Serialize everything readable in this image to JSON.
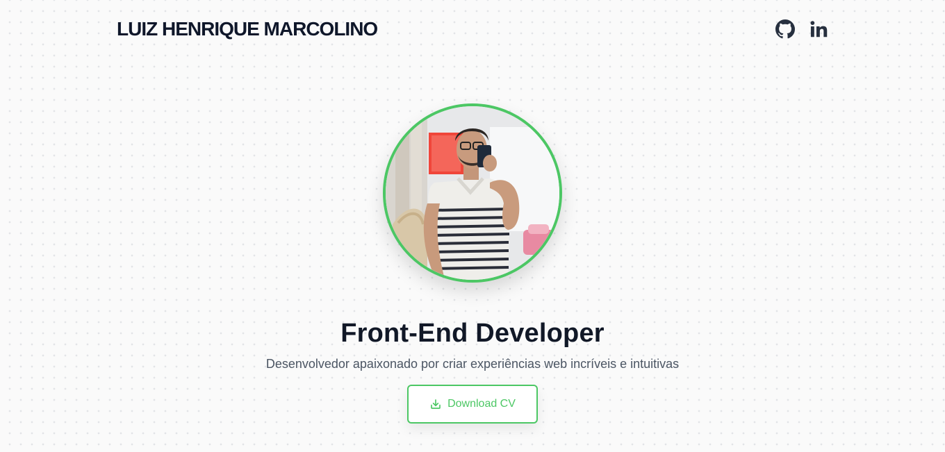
{
  "header": {
    "brand_name": "LUIZ HENRIQUE MARCOLINO",
    "social_icons": [
      "github-icon",
      "linkedin-icon"
    ]
  },
  "hero": {
    "profile_photo_icon": "profile-photo",
    "role_title": "Front-End Developer",
    "subtitle": "Desenvolvedor apaixonado por criar experiências web incríveis e intuitivas",
    "download_button": {
      "label": "Download CV",
      "icon": "download-icon"
    }
  },
  "colors": {
    "accent": "#4cc764",
    "heading": "#111827",
    "body_text": "#4b5563",
    "background": "#fafafa"
  }
}
